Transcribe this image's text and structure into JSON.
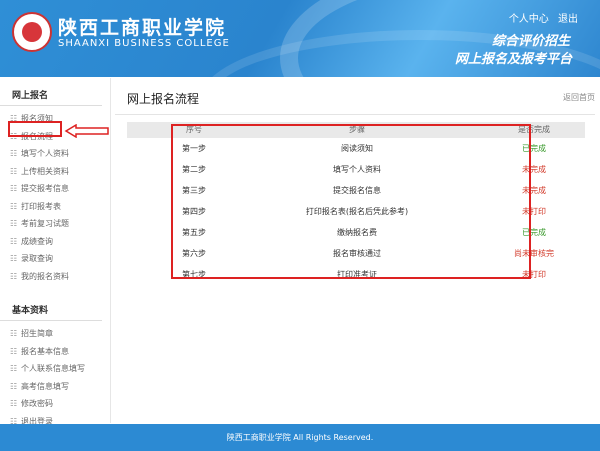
{
  "header": {
    "school_cn": "陕西工商职业学院",
    "school_en": "SHAANXI BUSINESS COLLEGE",
    "links": [
      "个人中心",
      "退出"
    ],
    "slogan_line1": "综合评价招生",
    "slogan_line2": "网上报名及报考平台"
  },
  "sidebar": {
    "sections": [
      {
        "title": "网上报名",
        "items": [
          "报名须知",
          "报名流程",
          "填写个人资料",
          "上传相关资料",
          "提交报考信息",
          "打印报考表",
          "考前复习试题",
          "成绩查询",
          "录取查询",
          "我的报名资料"
        ]
      },
      {
        "title": "基本资料",
        "items": [
          "招生简章",
          "报名基本信息",
          "个人联系信息填写",
          "高考信息填写",
          "修改密码",
          "退出登录"
        ]
      }
    ]
  },
  "main": {
    "title": "网上报名流程",
    "back": "返回首页",
    "columns": [
      "序号",
      "步骤",
      "是否完成"
    ],
    "rows": [
      {
        "no": "第一步",
        "step": "阅读须知",
        "status": "已完成",
        "color": "#3a9a2c"
      },
      {
        "no": "第二步",
        "step": "填写个人资料",
        "status": "未完成",
        "color": "#d23a2a"
      },
      {
        "no": "第三步",
        "step": "提交报名信息",
        "status": "未完成",
        "color": "#d23a2a"
      },
      {
        "no": "第四步",
        "step": "打印报名表(报名后凭此参考)",
        "status": "未打印",
        "color": "#d23a2a"
      },
      {
        "no": "第五步",
        "step": "缴纳报名费",
        "status": "已完成",
        "color": "#3a9a2c"
      },
      {
        "no": "第六步",
        "step": "报名审核通过",
        "status": "尚未审核完",
        "color": "#d23a2a"
      },
      {
        "no": "第七步",
        "step": "打印准考证",
        "status": "未打印",
        "color": "#d23a2a"
      }
    ]
  },
  "footer": {
    "text": "陕西工商职业学院 All Rights Reserved."
  }
}
